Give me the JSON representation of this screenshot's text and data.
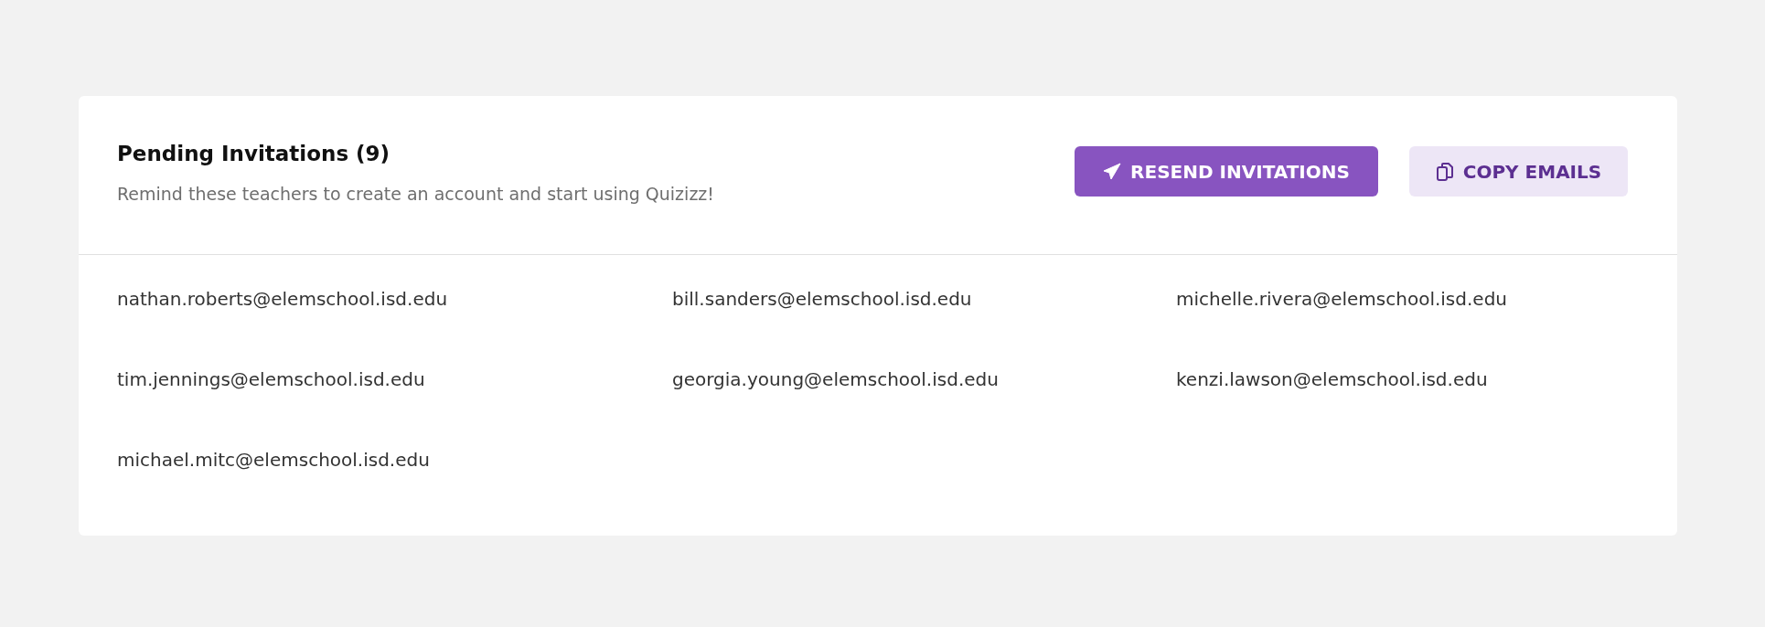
{
  "header": {
    "title": "Pending Invitations (9)",
    "subtitle": "Remind these teachers to create an account and start using Quizizz!"
  },
  "buttons": [
    {
      "kind": "primary",
      "label": "RESEND INVITATIONS"
    },
    {
      "kind": "secondary",
      "label": "COPY EMAILS"
    }
  ],
  "emails": [
    "nathan.roberts@elemschool.isd.edu",
    "bill.sanders@elemschool.isd.edu",
    "michelle.rivera@elemschool.isd.edu",
    "tim.jennings@elemschool.isd.edu",
    "georgia.young@elemschool.isd.edu",
    "kenzi.lawson@elemschool.isd.edu",
    "michael.mitc@elemschool.isd.edu"
  ]
}
